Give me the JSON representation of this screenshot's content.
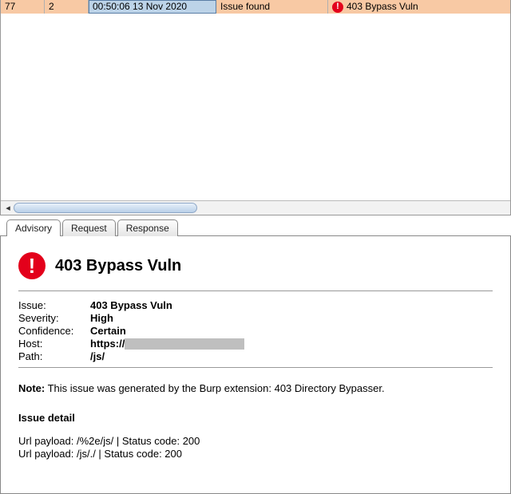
{
  "row": {
    "col0": "77",
    "col1": "2",
    "time": "00:50:06 13 Nov 2020",
    "status": "Issue found",
    "issue": "403 Bypass Vuln"
  },
  "tabs": {
    "advisory": "Advisory",
    "request": "Request",
    "response": "Response"
  },
  "detail": {
    "title": "403 Bypass Vuln",
    "labels": {
      "issue": "Issue:",
      "severity": "Severity:",
      "confidence": "Confidence:",
      "host": "Host:",
      "path": "Path:"
    },
    "issue": "403 Bypass Vuln",
    "severity": "High",
    "confidence": "Certain",
    "host_prefix": "https://",
    "path": "/js/",
    "note_label": "Note:",
    "note_text": " This issue was generated by the Burp extension: 403 Directory Bypasser.",
    "section_head": "Issue detail",
    "payloads": [
      "Url payload: /%2e/js/ | Status code: 200",
      "Url payload: /js/./ | Status code: 200"
    ]
  }
}
